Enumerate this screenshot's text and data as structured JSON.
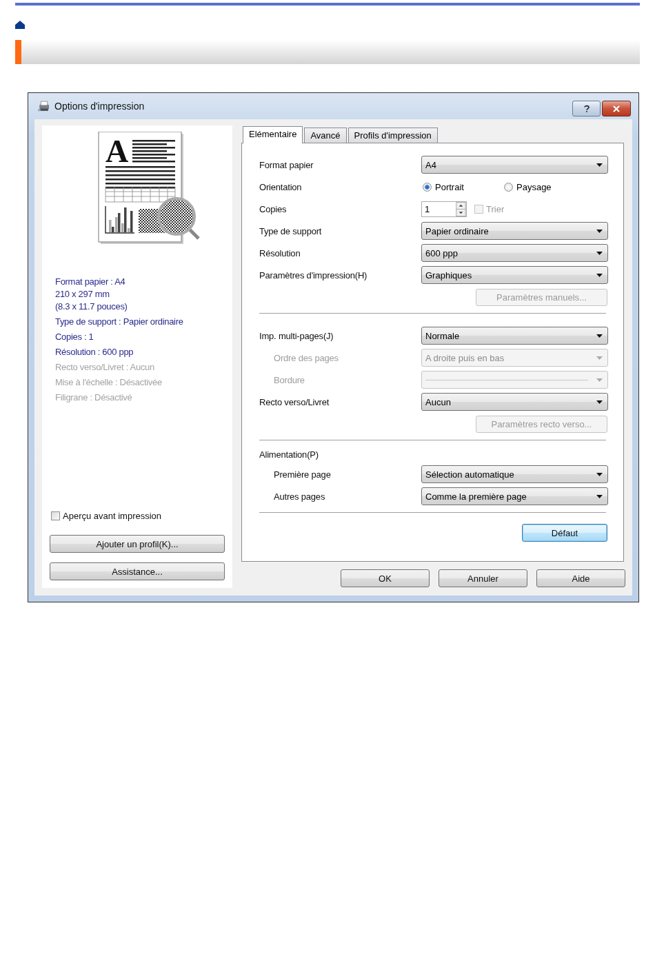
{
  "dialog": {
    "title": "Options d'impression",
    "preview": {
      "glyph": "A"
    },
    "summary": [
      {
        "lines": [
          "Format papier : A4",
          "210 x 297 mm",
          "(8.3 x 11.7 pouces)"
        ],
        "disabled": false
      },
      {
        "lines": [
          "Type de support : Papier ordinaire"
        ],
        "disabled": false
      },
      {
        "lines": [
          "Copies : 1"
        ],
        "disabled": false
      },
      {
        "lines": [
          "Résolution : 600 ppp"
        ],
        "disabled": false
      },
      {
        "lines": [
          "Recto verso/Livret : Aucun"
        ],
        "disabled": true
      },
      {
        "lines": [
          "Mise à l'échelle : Désactivée"
        ],
        "disabled": true
      },
      {
        "lines": [
          "Filigrane : Désactivé"
        ],
        "disabled": true
      }
    ],
    "preview_checkbox": {
      "label": "Aperçu avant impression",
      "checked": false
    },
    "side_buttons": [
      "Ajouter un profil(K)...",
      "Assistance..."
    ],
    "tabs": [
      {
        "label": "Elémentaire",
        "selected": true
      },
      {
        "label": "Avancé",
        "selected": false
      },
      {
        "label": "Profils d'impression",
        "selected": false
      }
    ],
    "settings": [
      {
        "kind": "select",
        "label": "Format papier",
        "value": "A4",
        "disabled": false
      },
      {
        "kind": "radio",
        "label": "Orientation",
        "options": [
          {
            "label": "Portrait",
            "selected": true
          },
          {
            "label": "Paysage",
            "selected": false
          }
        ]
      },
      {
        "kind": "spin",
        "label": "Copies",
        "value": "1",
        "checkbox": {
          "label": "Trier",
          "checked": false,
          "disabled": true
        }
      },
      {
        "kind": "select",
        "label": "Type de support",
        "value": "Papier ordinaire",
        "disabled": false
      },
      {
        "kind": "select",
        "label": "Résolution",
        "value": "600 ppp",
        "disabled": false
      },
      {
        "kind": "select",
        "label": "Paramètres d'impression(H)",
        "value": "Graphiques",
        "disabled": false
      },
      {
        "kind": "button",
        "label": "Paramètres manuels...",
        "disabled": true
      },
      {
        "kind": "separator"
      },
      {
        "kind": "select",
        "label": "Imp. multi-pages(J)",
        "value": "Normale",
        "disabled": false,
        "children": [
          {
            "kind": "select",
            "label": "Ordre des pages",
            "value": "A droite puis en bas",
            "disabled": true
          },
          {
            "kind": "line-select",
            "label": "Bordure",
            "disabled": true
          }
        ]
      },
      {
        "kind": "select",
        "label": "Recto verso/Livret",
        "value": "Aucun",
        "disabled": false
      },
      {
        "kind": "button",
        "label": "Paramètres recto verso...",
        "disabled": true
      },
      {
        "kind": "separator"
      },
      {
        "kind": "heading",
        "label": "Alimentation(P)",
        "children": [
          {
            "kind": "select",
            "label": "Première page",
            "value": "Sélection automatique",
            "disabled": false
          },
          {
            "kind": "select",
            "label": "Autres pages",
            "value": "Comme la première page",
            "disabled": false
          }
        ]
      },
      {
        "kind": "separator"
      }
    ],
    "default_button": {
      "label": "Défaut",
      "focused": true
    },
    "buttons": [
      {
        "label": "OK"
      },
      {
        "label": "Annuler"
      },
      {
        "label": "Aide"
      }
    ]
  }
}
